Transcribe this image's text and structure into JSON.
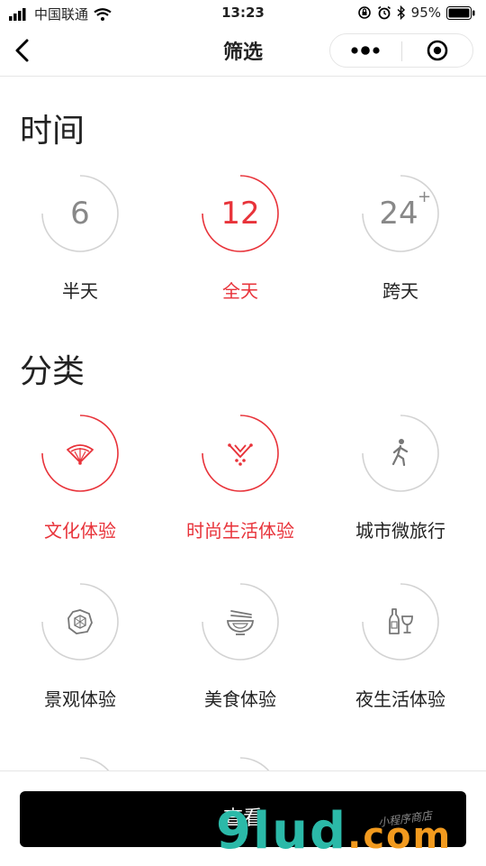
{
  "status": {
    "carrier": "中国联通",
    "time": "13:23",
    "battery": "95%"
  },
  "nav": {
    "title": "筛选",
    "back_icon": "chevron-left-icon",
    "more_icon": "more-dots-icon",
    "close_icon": "target-circle-icon"
  },
  "sections": {
    "time_title": "时间",
    "category_title": "分类"
  },
  "time_options": [
    {
      "value": "6",
      "label": "半天",
      "active": false
    },
    {
      "value": "12",
      "label": "全天",
      "active": true
    },
    {
      "value": "24",
      "sup": "+",
      "label": "跨天",
      "active": false
    }
  ],
  "category_options": [
    {
      "icon": "folding-fan-icon",
      "label": "文化体验",
      "active": true
    },
    {
      "icon": "fashion-ornament-icon",
      "label": "时尚生活体验",
      "active": true
    },
    {
      "icon": "walking-person-icon",
      "label": "城市微旅行",
      "active": false
    },
    {
      "icon": "landscape-ornament-icon",
      "label": "景观体验",
      "active": false
    },
    {
      "icon": "noodle-bowl-icon",
      "label": "美食体验",
      "active": false
    },
    {
      "icon": "wine-bottle-glass-icon",
      "label": "夜生活体验",
      "active": false
    }
  ],
  "bottom": {
    "view_button": "查看"
  },
  "watermark": {
    "main": "9lud",
    "domain": ".com",
    "sub": "小程序商店"
  },
  "colors": {
    "accent": "#e8333a",
    "inactive": "#888888",
    "button": "#000000"
  }
}
